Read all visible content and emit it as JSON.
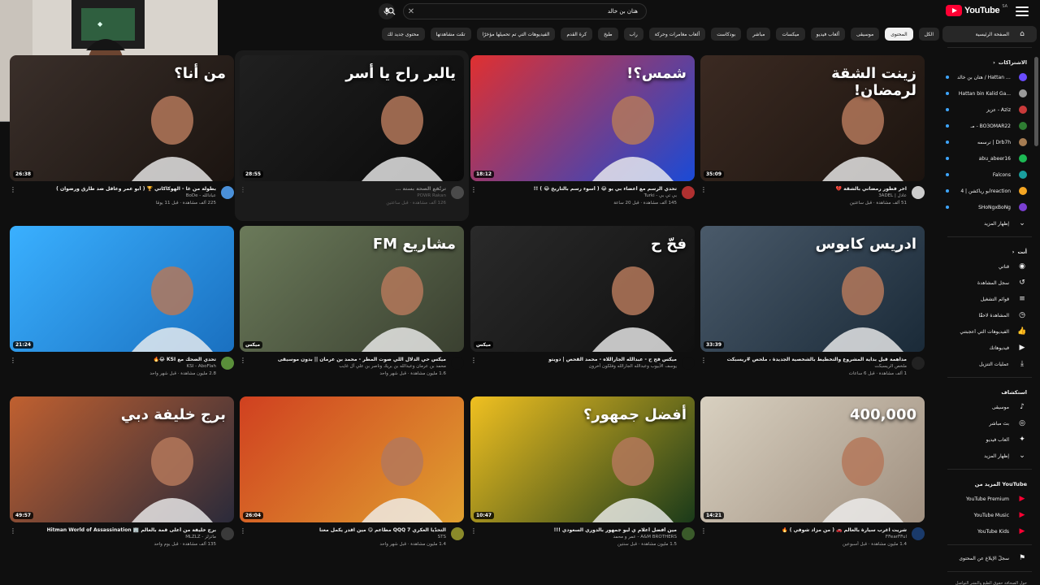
{
  "app": {
    "logo_text": "YouTube",
    "logo_region": "SA"
  },
  "search": {
    "value": "هتان بن خالد",
    "placeholder": "بحث"
  },
  "chips": [
    {
      "label": "الكل",
      "active": false
    },
    {
      "label": "المحتوى",
      "active": true
    },
    {
      "label": "موسيقى",
      "active": false
    },
    {
      "label": "ألعاب فيديو",
      "active": false
    },
    {
      "label": "ميكسات",
      "active": false
    },
    {
      "label": "مباشر",
      "active": false
    },
    {
      "label": "بودكاست",
      "active": false
    },
    {
      "label": "ألعاب مغامرات وحركة",
      "active": false
    },
    {
      "label": "راب",
      "active": false
    },
    {
      "label": "طبخ",
      "active": false
    },
    {
      "label": "كرة القدم",
      "active": false
    },
    {
      "label": "الفيديوهات التي تم تحميلها مؤخرًا",
      "active": false
    },
    {
      "label": "تمّت مشاهدتها",
      "active": false
    },
    {
      "label": "محتوى جديد لك",
      "active": false
    }
  ],
  "sidebar": {
    "home": "الصفحة الرئيسية",
    "subs_header": "الاشتراكات",
    "subs": [
      {
        "label": "هتان بن خالد / Hattan khalid",
        "color": "#6a4cff"
      },
      {
        "label": "Hattan bin Kalid Ga...",
        "color": "#9a9a9a"
      },
      {
        "label": "عزيز - Aziz",
        "color": "#c93a3a"
      },
      {
        "label": "مـ - BO3OMAR22",
        "color": "#2e7d32"
      },
      {
        "label": "ترسمه | Drb7h",
        "color": "#a67c52"
      },
      {
        "label": "abu_abeer16",
        "color": "#1db954"
      },
      {
        "label": "Falcons",
        "color": "#1aa0a0"
      },
      {
        "label": "أبو رياكشن | 4reaction",
        "color": "#f5a623"
      },
      {
        "label": "SHoNgxBoNg",
        "color": "#7a3fd1"
      }
    ],
    "show_more": "إظهار المزيد",
    "you_header": "أنت",
    "you_items": [
      {
        "label": "قناتي",
        "icon": "channel-icon"
      },
      {
        "label": "سجل المشاهدة",
        "icon": "history-icon"
      },
      {
        "label": "قوائم التشغيل",
        "icon": "playlists-icon"
      },
      {
        "label": "المشاهدة لاحقًا",
        "icon": "watch-later-icon"
      },
      {
        "label": "الفيديوهات التي أعجبتني",
        "icon": "like-icon"
      },
      {
        "label": "فيديوهاتك",
        "icon": "your-videos-icon"
      },
      {
        "label": "عمليات التنزيل",
        "icon": "download-icon"
      }
    ],
    "explore_header": "استكشاف",
    "explore_items": [
      {
        "label": "موسيقى",
        "icon": "music-icon"
      },
      {
        "label": "بث مباشر",
        "icon": "live-icon"
      },
      {
        "label": "ألعاب فيديو",
        "icon": "gaming-icon"
      },
      {
        "label": "إظهار المزيد",
        "icon": "chevron-down-icon"
      }
    ],
    "more_header": "المزيد من YouTube",
    "more_items": [
      {
        "label": "YouTube Premium",
        "color": "#ff0033"
      },
      {
        "label": "YouTube Music",
        "color": "#ff0033"
      },
      {
        "label": "YouTube Kids",
        "color": "#ff0033"
      }
    ],
    "report": "سجلّ الإبلاغ عن المحتوى",
    "footer": "حول  الصحافة  حقوق الطبع والنشر  التواصل معنا  صانعو المحتوى  الإعلان  مطوّري البرامج"
  },
  "videos": [
    {
      "title": "بطولة من غا - الهوكاكاتي 🏆 ( أبو عمر وعاقل ضد طارق ورضوان )",
      "channel": "عبادالله - BoDe",
      "stats": "225 ألف مشاهدة · قبل 11 يومًا",
      "duration": "26:38",
      "thumb_text": "من أنا؟",
      "bg1": "#3a2f2a",
      "bg2": "#1b1410",
      "avatar": "#4a90d9"
    },
    {
      "title": "ترنّفع الصحة بستة ...",
      "channel": "POWR Rakan",
      "stats": "126 ألف مشاهدة · قبل ساعتين",
      "duration": "28:55",
      "thumb_text": "يالبر راح يا أسر",
      "bg1": "#202020",
      "bg2": "#0a0a0a",
      "avatar": "#777777"
    },
    {
      "title": "تحدي الرسم مع أعضاء بي يو 😂 ( أسوء رسم بالتاريخ 😂 ) !!",
      "channel": "بي تي بي - Turki",
      "stats": "145 ألف مشاهدة · قبل 20 ساعة",
      "duration": "18:12",
      "thumb_text": "شمس؟!",
      "bg1": "#e03030",
      "bg2": "#1a4ad6",
      "avatar": "#b03030"
    },
    {
      "title": "اخر فطور رمضاني بالشقة 💔",
      "channel": "عادل | 3ADEL",
      "stats": "51 ألف مشاهدة · قبل ساعتين",
      "duration": "35:09",
      "thumb_text": "زينت الشقة لرمضان!",
      "bg1": "#3b2a22",
      "bg2": "#1c140f",
      "avatar": "#cccccc"
    },
    {
      "title": "تحدي الضحك مع KSI 😂🔥",
      "channel": "KSI - AboFlah",
      "stats": "2.8 مليون مشاهدة · قبل شهر واحد",
      "duration": "21:24",
      "thumb_text": "",
      "bg1": "#3ab0ff",
      "bg2": "#1a70c0",
      "avatar": "#5a8f3a"
    },
    {
      "title": "ميكس حي الدلال اللي صوت المطر - محمد بن عرمان || بدون موسيقى",
      "channel": "محمد بن عرمان وعبدالله بن بريك وناصر بن علي آل غايب",
      "stats": "1.6 مليون مشاهدة · قبل شهر واحد",
      "duration": "ميكس",
      "thumb_text": "مشاريع FM",
      "bg1": "#6b7a5a",
      "bg2": "#3a4030",
      "avatar": "#0f0f0f"
    },
    {
      "title": "ميكس فح ح - عبدالله الجاراللاه - محمد القحص | دويتو",
      "channel": "يوسف الأبيوب وعبدالله الجارالله وفلكون أخرون",
      "stats": "",
      "duration": "ميكس",
      "thumb_text": "فحّ ح",
      "bg1": "#2a2a2a",
      "bg2": "#101010",
      "avatar": "#0f0f0f"
    },
    {
      "title": "مداهمة قبل بداية المشروع والتخطيط بالشخصية الجديدة ، ملحص #ريسبكت",
      "channel": "ملخص الريسبكت",
      "stats": "1 ألف مشاهدة · قبل 6 ساعات",
      "duration": "33:39",
      "thumb_text": "ادريس كابوس",
      "bg1": "#4a5a6a",
      "bg2": "#1a2a38",
      "avatar": "#222222"
    },
    {
      "title": "برج خليفة من أعلى قمة بالعالم 🏢 Hitman World of Assassination",
      "channel": "ماتزلز - MLZLZ",
      "stats": "135 ألف مشاهدة · قبل يوم واحد",
      "duration": "49:57",
      "thumb_text": "برج خليفة دبي",
      "bg1": "#c06030",
      "bg2": "#2a2a3a",
      "avatar": "#3a3a3a"
    },
    {
      "title": "التحدّيا العكري QQQ 7 مطاعم 😋 مين اقدر يكمل معنا",
      "channel": "STS",
      "stats": "1.4 مليون مشاهدة · قبل شهر واحد",
      "duration": "26:04",
      "thumb_text": "",
      "bg1": "#d04020",
      "bg2": "#e0a030",
      "avatar": "#8a8a2a"
    },
    {
      "title": "مين أفضل أعلام ي ليو جمهور بالدوري السعودي !!!",
      "channel": "A&M BROTHERS - عمر و محمد",
      "stats": "1.5 مليون مشاهدة · قبل سنتين",
      "duration": "10:47",
      "thumb_text": "أفضل جمهور؟",
      "bg1": "#f0c020",
      "bg2": "#1a3a1a",
      "avatar": "#3a5a2a"
    },
    {
      "title": "شريت اغرب سيارة بالعالم 🚗 ( من مزاد شوفي ) 🔥",
      "channel": "FFearFFul",
      "stats": "1.4 مليون مشاهدة · قبل أسبوعين",
      "duration": "14:21",
      "thumb_text": "400,000",
      "bg1": "#d8d0c0",
      "bg2": "#a09080",
      "avatar": "#1a3a6a"
    }
  ],
  "webcam": {
    "label": "الصفحة الرئيسية"
  }
}
